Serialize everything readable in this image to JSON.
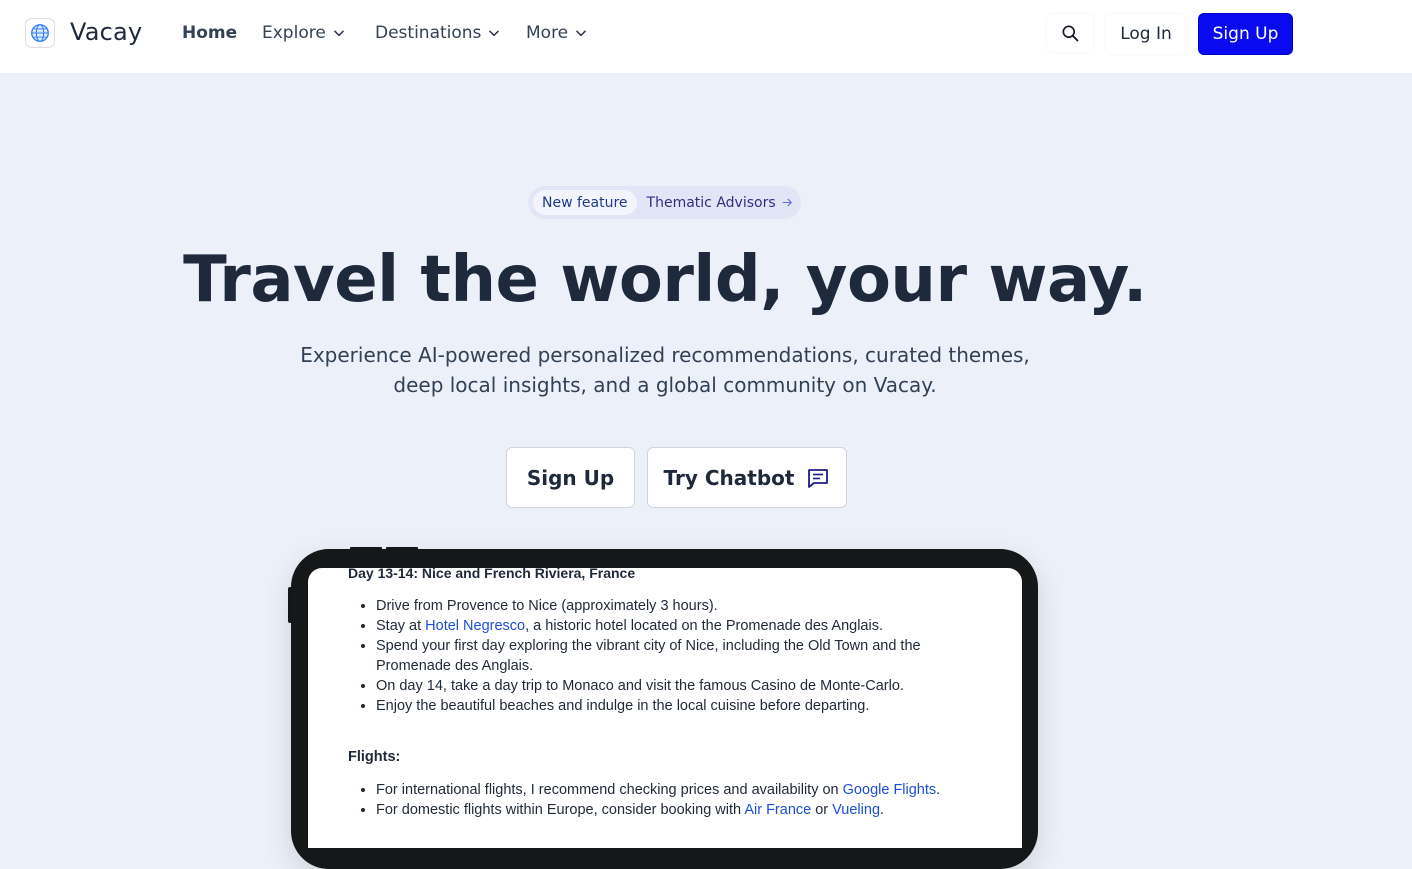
{
  "nav": {
    "brand": "Vacay",
    "items": [
      {
        "label": "Home"
      },
      {
        "label": "Explore"
      },
      {
        "label": "Destinations"
      },
      {
        "label": "More"
      }
    ],
    "login": "Log In",
    "signup": "Sign Up"
  },
  "hero": {
    "badge": "New feature",
    "badge_link": "Thematic Advisors",
    "headline": "Travel the world, your way.",
    "subline": "Experience AI-powered personalized recommendations, curated themes, deep local insights, and a global community on Vacay.",
    "cta_signup": "Sign Up",
    "cta_chat": "Try Chatbot"
  },
  "screen": {
    "day_title": "Day 13-14: Nice and French Riviera, France",
    "day_items": {
      "i0": "Drive from Provence to Nice (approximately 3 hours).",
      "i1_pre": "Stay at ",
      "i1_link": "Hotel Negresco",
      "i1_post": ", a historic hotel located on the Promenade des Anglais.",
      "i2": "Spend your first day exploring the vibrant city of Nice, including the Old Town and the Promenade des Anglais.",
      "i3": "On day 14, take a day trip to Monaco and visit the famous Casino de Monte-Carlo.",
      "i4": "Enjoy the beautiful beaches and indulge in the local cuisine before departing."
    },
    "flights_title": "Flights:",
    "flights": {
      "f0_pre": "For international flights, I recommend checking prices and availability on ",
      "f0_link": "Google Flights",
      "f0_post": ".",
      "f1_pre": "For domestic flights within Europe, consider booking with ",
      "f1_link1": "Air France",
      "f1_mid": " or ",
      "f1_link2": "Vueling",
      "f1_post": "."
    }
  },
  "colors": {
    "primary": "#0a0af0",
    "background": "#ecf0f8",
    "link": "#1d4ed8"
  },
  "icons": [
    "globe-icon",
    "chevron-down-icon",
    "search-icon",
    "arrow-right-icon",
    "chat-icon"
  ]
}
